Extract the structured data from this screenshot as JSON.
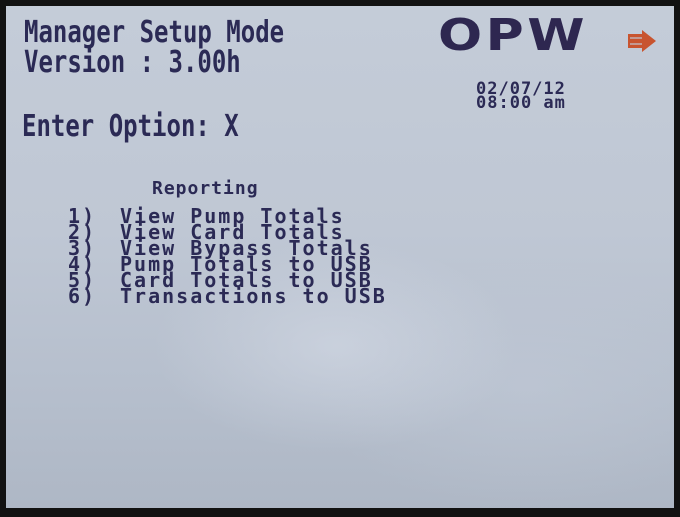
{
  "header": {
    "title": "Manager Setup Mode",
    "version": "Version : 3.00h"
  },
  "logo": {
    "text": "OPW",
    "arrow_icon": "arrow-right-icon"
  },
  "datetime": {
    "date": "02/07/12",
    "time": "08:00 am"
  },
  "prompt": "Enter Option: X",
  "menu": {
    "heading": "Reporting",
    "items": [
      {
        "num": "1)",
        "label": "View Pump Totals"
      },
      {
        "num": "2)",
        "label": "View Card Totals"
      },
      {
        "num": "3)",
        "label": "View Bypass Totals"
      },
      {
        "num": "4)",
        "label": "Pump Totals to USB"
      },
      {
        "num": "5)",
        "label": "Card Totals to USB"
      },
      {
        "num": "6)",
        "label": "Transactions to USB"
      }
    ]
  },
  "colors": {
    "screen_bg": "#c0c8d5",
    "text": "#2b2a55",
    "logo": "#2e2750",
    "logo_arrow": "#c8542f",
    "bezel": "#121212"
  }
}
